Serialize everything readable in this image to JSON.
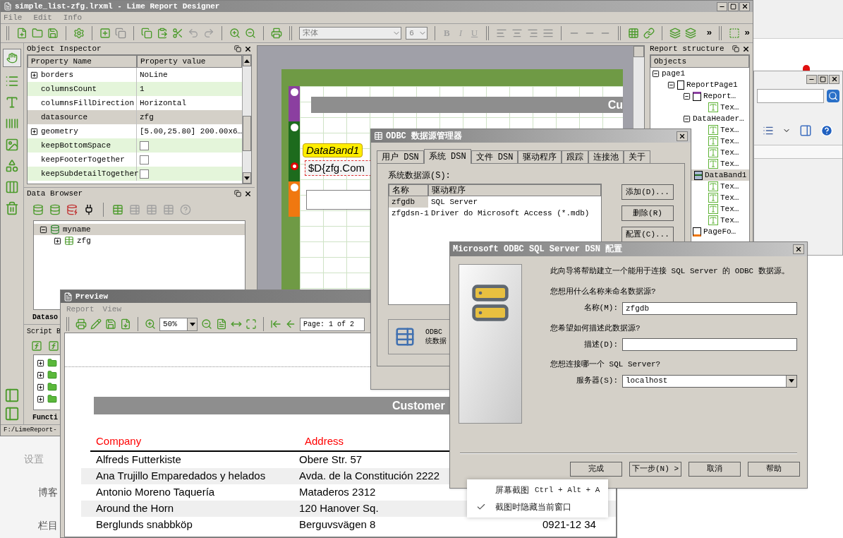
{
  "designer": {
    "title": "simple_list-zfg.lrxml - Lime Report Designer",
    "menu": [
      "File",
      "Edit",
      "Info"
    ],
    "font_name": "宋体",
    "font_size": "6",
    "format_buttons": [
      "B",
      "I",
      "U"
    ],
    "overflow_buttons": [
      "»",
      "»"
    ],
    "object_inspector": {
      "title": "Object Inspector",
      "columns": [
        "Property Name",
        "Property value"
      ],
      "rows": [
        {
          "name": "borders",
          "kind": "group",
          "value": "NoLine",
          "selected": false
        },
        {
          "name": "columnsCount",
          "kind": "text",
          "value": "1",
          "selected": false
        },
        {
          "name": "columnsFillDirection",
          "kind": "text",
          "value": "Horizontal",
          "selected": false
        },
        {
          "name": "datasource",
          "kind": "text",
          "value": "zfg",
          "selected": true
        },
        {
          "name": "geometry",
          "kind": "group",
          "value": "[5.00,25.80] 200.00x6…",
          "selected": false
        },
        {
          "name": "keepBottomSpace",
          "kind": "checkbox",
          "checked": false,
          "selected": false
        },
        {
          "name": "keepFooterTogether",
          "kind": "checkbox",
          "checked": false,
          "selected": false
        },
        {
          "name": "keepSubdetailTogether",
          "kind": "checkbox",
          "checked": false,
          "selected": false
        }
      ]
    },
    "data_browser": {
      "title": "Data Browser",
      "tree": [
        {
          "label": "myname",
          "expanded": true,
          "selected": true,
          "children": [
            {
              "label": "zfg",
              "expanded": false,
              "selected": false
            }
          ]
        }
      ],
      "tab": "Dataso"
    },
    "script_browser": {
      "title": "Script B",
      "items": [
        {
          "kind": "folder"
        },
        {
          "kind": "folder"
        },
        {
          "kind": "folder"
        },
        {
          "kind": "folder"
        }
      ],
      "tab": "Functi"
    },
    "status_bar": "F:/LimeReport-",
    "canvas": {
      "header_text": "Cu",
      "band_label": "DataBand1",
      "field_text": "$D{zfg.Com"
    },
    "report_structure": {
      "title": "Report structure",
      "column": "Objects",
      "tree": [
        {
          "label": "page1",
          "selected": false,
          "children": [
            {
              "label": "ReportPage1",
              "kind": "page",
              "selected": false,
              "children": [
                {
                  "label": "Report…",
                  "kind": "header",
                  "selected": false,
                  "children": [
                    {
                      "label": "Tex…",
                      "kind": "text",
                      "selected": false
                    }
                  ]
                },
                {
                  "label": "DataHeader…",
                  "selected": false,
                  "children": [
                    {
                      "label": "Tex…",
                      "kind": "text",
                      "selected": false
                    },
                    {
                      "label": "Tex…",
                      "kind": "text",
                      "selected": false
                    },
                    {
                      "label": "Tex…",
                      "kind": "text",
                      "selected": false
                    },
                    {
                      "label": "Tex…",
                      "kind": "text",
                      "selected": false
                    }
                  ]
                },
                {
                  "label": "DataBand1",
                  "kind": "band",
                  "selected": true,
                  "children": [
                    {
                      "label": "Tex…",
                      "kind": "text",
                      "selected": false
                    },
                    {
                      "label": "Tex…",
                      "kind": "text",
                      "selected": false
                    },
                    {
                      "label": "Tex…",
                      "kind": "text",
                      "selected": false
                    },
                    {
                      "label": "Tex…",
                      "kind": "text",
                      "selected": false
                    }
                  ]
                },
                {
                  "label": "PageFo…",
                  "kind": "footer",
                  "selected": false
                }
              ]
            }
          ]
        }
      ]
    }
  },
  "background_page": {
    "items": [
      "设置",
      "博客",
      "栏目"
    ]
  },
  "preview": {
    "title": "Preview",
    "menu": [
      "Report",
      "View"
    ],
    "zoom": "50%",
    "page": "Page: 1 of 2",
    "report": {
      "title": "Customer",
      "columns": [
        "Company",
        "Address"
      ],
      "rows": [
        {
          "company": "Alfreds Futterkiste",
          "address": "Obere Str. 57"
        },
        {
          "company": "Ana Trujillo Emparedados y helados",
          "address": "Avda. de la Constitución 2222"
        },
        {
          "company": "Antonio Moreno Taquería",
          "address": "Mataderos  2312"
        },
        {
          "company": "Around the Horn",
          "address": "120 Hanover Sq."
        },
        {
          "company": "Berglunds snabbköp",
          "address": "Berguvsvägen  8",
          "phone": "0921-12 34"
        }
      ]
    }
  },
  "odbc_dialog": {
    "title": "ODBC 数据源管理器",
    "tabs": [
      {
        "label": "用户 DSN",
        "selected": false
      },
      {
        "label": "系统 DSN",
        "selected": true
      },
      {
        "label": "文件 DSN",
        "selected": false
      },
      {
        "label": "驱动程序",
        "selected": false
      },
      {
        "label": "跟踪",
        "selected": false
      },
      {
        "label": "连接池",
        "selected": false
      },
      {
        "label": "关于",
        "selected": false
      }
    ],
    "list_label": "系统数据源(S):",
    "columns": [
      "名称",
      "驱动程序"
    ],
    "rows": [
      {
        "name": "zfgdb",
        "driver": "SQL Server",
        "selected": true
      },
      {
        "name": "zfgdsn-1",
        "driver": "Driver do Microsoft Access (*.mdb)",
        "selected": false
      }
    ],
    "buttons": [
      "添加(D)...",
      "删除(R)",
      "配置(C)..."
    ],
    "info": [
      "ODBC",
      "统数据"
    ]
  },
  "sql_dialog": {
    "title": "Microsoft ODBC SQL Server DSN 配置",
    "intro": "此向导将帮助建立一个能用于连接 SQL Server 的 ODBC 数据源。",
    "fields": [
      {
        "question": "您想用什么名称来命名数据源?",
        "label": "名称(M):",
        "value": "zfgdb",
        "kind": "text"
      },
      {
        "question": "您希望如何描述此数据源?",
        "label": "描述(D):",
        "kind": "text"
      },
      {
        "question": "您想连接哪一个 SQL Server?",
        "label": "服务器(S):",
        "value": "localhost",
        "kind": "select"
      }
    ],
    "buttons": [
      "完成",
      "下一步(N) >",
      "取消",
      "帮助"
    ]
  },
  "context_menu": {
    "items": [
      {
        "label": "屏幕截图",
        "shortcut": "Ctrl + Alt + A",
        "checked": false
      },
      {
        "label": "截图时隐藏当前窗口",
        "checked": true
      }
    ]
  }
}
